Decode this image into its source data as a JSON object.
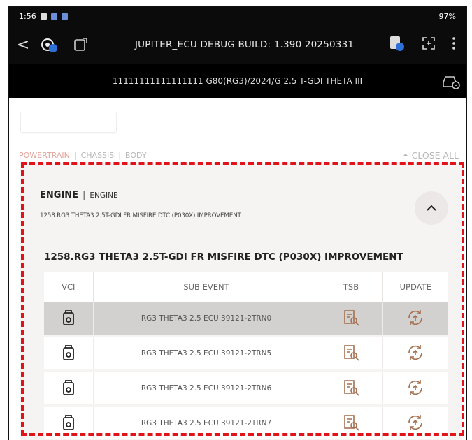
{
  "status_bar": {
    "time": "1:56",
    "right": "97%"
  },
  "app_bar": {
    "back_label": "<",
    "title": "JUPITER_ECU DEBUG BUILD: 1.390 20250331"
  },
  "sub_bar": {
    "vehicle": "11111111111111111  G80(RG3)/2024/G 2.5 T-GDI THETA III"
  },
  "filters": {
    "categories": [
      {
        "label": "POWERTRAIN",
        "active": true
      },
      {
        "label": "CHASSIS",
        "active": false
      },
      {
        "label": "BODY",
        "active": false
      }
    ],
    "separator": "|",
    "close_all": "CLOSE ALL"
  },
  "engine_card": {
    "title": "ENGINE",
    "separator": "|",
    "subtitle": "ENGINE",
    "description": "1258.RG3 THETA3 2.5T-GDI FR MISFIRE DTC (P030X) IMPROVEMENT",
    "section_title": "1258.RG3 THETA3 2.5T-GDI FR MISFIRE DTC (P030X) IMPROVEMENT",
    "columns": [
      "VCI",
      "SUB EVENT",
      "TSB",
      "UPDATE"
    ],
    "rows": [
      {
        "sub_event": "RG3 THETA3 2.5 ECU 39121-2TRN0",
        "selected": true
      },
      {
        "sub_event": "RG3 THETA3 2.5 ECU 39121-2TRN5",
        "selected": false
      },
      {
        "sub_event": "RG3 THETA3 2.5 ECU 39121-2TRN6",
        "selected": false
      },
      {
        "sub_event": "RG3 THETA3 2.5 ECU 39121-2TRN7",
        "selected": false
      }
    ]
  },
  "colors": {
    "highlight_border": "#e0121a",
    "active_tab": "#e4a49a",
    "selected_row": "#d3d1d0"
  }
}
